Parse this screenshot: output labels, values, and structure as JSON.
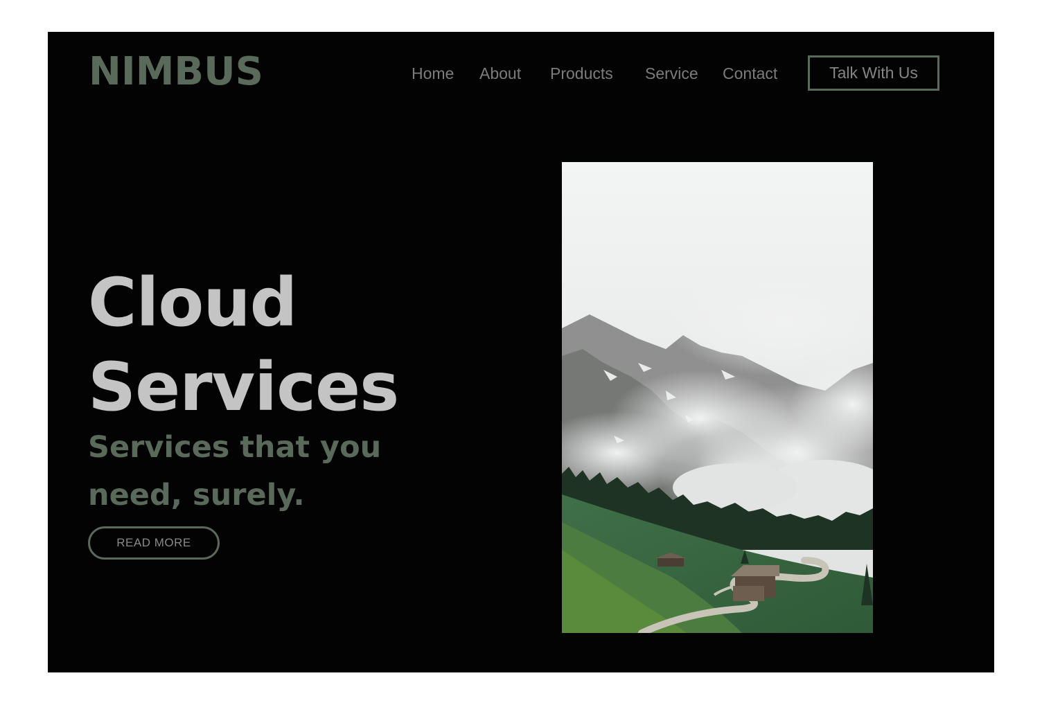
{
  "brand": {
    "name": "NIMBUS"
  },
  "nav": {
    "items": [
      {
        "label": "Home"
      },
      {
        "label": "About"
      },
      {
        "label": "Products"
      },
      {
        "label": "Service"
      },
      {
        "label": "Contact"
      }
    ],
    "cta_label": "Talk With Us"
  },
  "hero": {
    "title_line1": "Cloud",
    "title_line2": "Services",
    "subtitle": "Services that you need, surely.",
    "button_label": "READ MORE"
  },
  "photo": {
    "subject": "misty-mountain-valley-with-cabins"
  },
  "colors": {
    "background": "#030303",
    "accent": "#5a6a5a",
    "title": "#c4c4c4",
    "nav_text": "#7c7c7c"
  }
}
